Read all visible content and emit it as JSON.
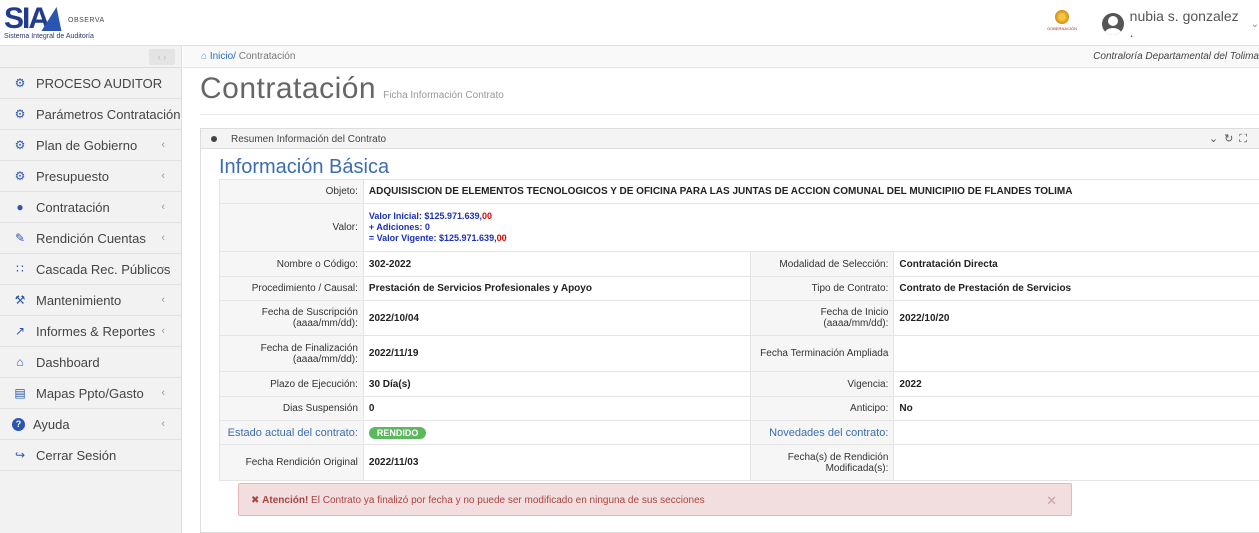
{
  "app": {
    "logo_text": "SIA",
    "logo_tag": "OBSERVA",
    "logo_subtitle": "Sistema Integral de Auditoría",
    "crest_text": "GOBERNACIÓN"
  },
  "user": {
    "name": "nubia s. gonzalez ."
  },
  "breadcrumb": {
    "home": "Inicio/",
    "current": "Contratación"
  },
  "entity": "Contraloría Departamental del Tolima",
  "sidebar": {
    "items": [
      {
        "label": "PROCESO AUDITOR",
        "icon": "cogs-icon",
        "chevron": false
      },
      {
        "label": "Parámetros Contratación",
        "icon": "cogs-icon",
        "chevron": false
      },
      {
        "label": "Plan de Gobierno",
        "icon": "cogs-icon",
        "chevron": true
      },
      {
        "label": "Presupuesto",
        "icon": "cogs-icon",
        "chevron": true
      },
      {
        "label": "Contratación",
        "icon": "circle-icon",
        "chevron": true
      },
      {
        "label": "Rendición Cuentas",
        "icon": "edit-icon",
        "chevron": true
      },
      {
        "label": "Cascada Rec. Públicos",
        "icon": "grid-icon",
        "chevron": true
      },
      {
        "label": "Mantenimiento",
        "icon": "wrench-icon",
        "chevron": true
      },
      {
        "label": "Informes & Reportes",
        "icon": "chart-icon",
        "chevron": true
      },
      {
        "label": "Dashboard",
        "icon": "home-icon",
        "chevron": false
      },
      {
        "label": "Mapas Ppto/Gasto",
        "icon": "map-icon",
        "chevron": true
      },
      {
        "label": "Ayuda",
        "icon": "question-icon",
        "chevron": true
      },
      {
        "label": "Cerrar Sesión",
        "icon": "logout-icon",
        "chevron": false
      }
    ]
  },
  "page": {
    "title": "Contratación",
    "subtitle": "Ficha Información Contrato"
  },
  "panel": {
    "title": "Resumen Información del Contrato"
  },
  "section": {
    "title": "Información Básica"
  },
  "info": {
    "objeto_label": "Objeto:",
    "objeto": "ADQUISISCION DE ELEMENTOS TECNOLOGICOS Y DE OFICINA PARA LAS JUNTAS DE ACCION COMUNAL DEL MUNICIPIIO DE FLANDES TOLIMA",
    "valor_label": "Valor:",
    "valor_inicial": "Valor Inicial: $125.971.639,",
    "valor_inicial_cents": "00",
    "adiciones": "+ Adiciones: 0",
    "valor_vigente": "= Valor Vigente: $125.971.639,",
    "valor_vigente_cents": "00",
    "nombre_label": "Nombre o Código:",
    "nombre": "302-2022",
    "modalidad_label": "Modalidad de Selección:",
    "modalidad": "Contratación Directa",
    "procedimiento_label": "Procedimiento / Causal:",
    "procedimiento": "Prestación de Servicios Profesionales y Apoyo",
    "tipo_label": "Tipo de Contrato:",
    "tipo": "Contrato de Prestación de Servicios",
    "suscripcion_label": "Fecha de Suscripción (aaaa/mm/dd):",
    "suscripcion": "2022/10/04",
    "inicio_label": "Fecha de Inicio (aaaa/mm/dd):",
    "inicio": "2022/10/20",
    "finalizacion_label": "Fecha de Finalización (aaaa/mm/dd):",
    "finalizacion": "2022/11/19",
    "terminacion_label": "Fecha Terminación Ampliada",
    "terminacion": "",
    "plazo_label": "Plazo de Ejecución:",
    "plazo": "30 Día(s)",
    "vigencia_label": "Vigencia:",
    "vigencia": "2022",
    "suspension_label": "Dias Suspensión",
    "suspension": "0",
    "anticipo_label": "Anticipo:",
    "anticipo": "No",
    "estado_label": "Estado actual del contrato:",
    "estado": "RENDIDO",
    "novedades_label": "Novedades del contrato:",
    "rendicion_label": "Fecha Rendición Original",
    "rendicion": "2022/11/03",
    "rendicion_mod_label": "Fecha(s) de Rendición Modificada(s):",
    "rendicion_mod": ""
  },
  "alert": {
    "strong": "Atención!",
    "text": " El Contrato ya finalizó por fecha y no puede ser modificado en ninguna de sus secciones"
  },
  "colors": {
    "accent": "#3c6db0",
    "badge": "#5cb85c",
    "alert_bg": "#f2dede",
    "alert_text": "#a94442"
  }
}
